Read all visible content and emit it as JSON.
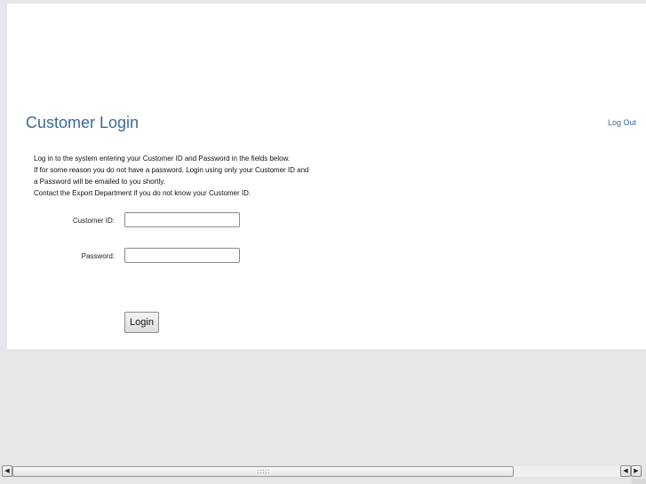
{
  "header": {
    "title": "Customer Login",
    "logout_label": "Log Out"
  },
  "instructions": [
    "Log in to the system entering your Customer ID and Password in the fields below.",
    "If for some reason you do not have a password. Login using only your Customer ID and",
    "a Password will be emailed to you shortly.",
    "Contact the Export Department if you do not know your Customer ID."
  ],
  "form": {
    "customer_id_label": "Customer ID:",
    "customer_id_value": "",
    "password_label": "Password:",
    "password_value": "",
    "login_label": "Login"
  },
  "scrollbar": {
    "left_arrow": "◀",
    "right_arrow": "▶"
  }
}
